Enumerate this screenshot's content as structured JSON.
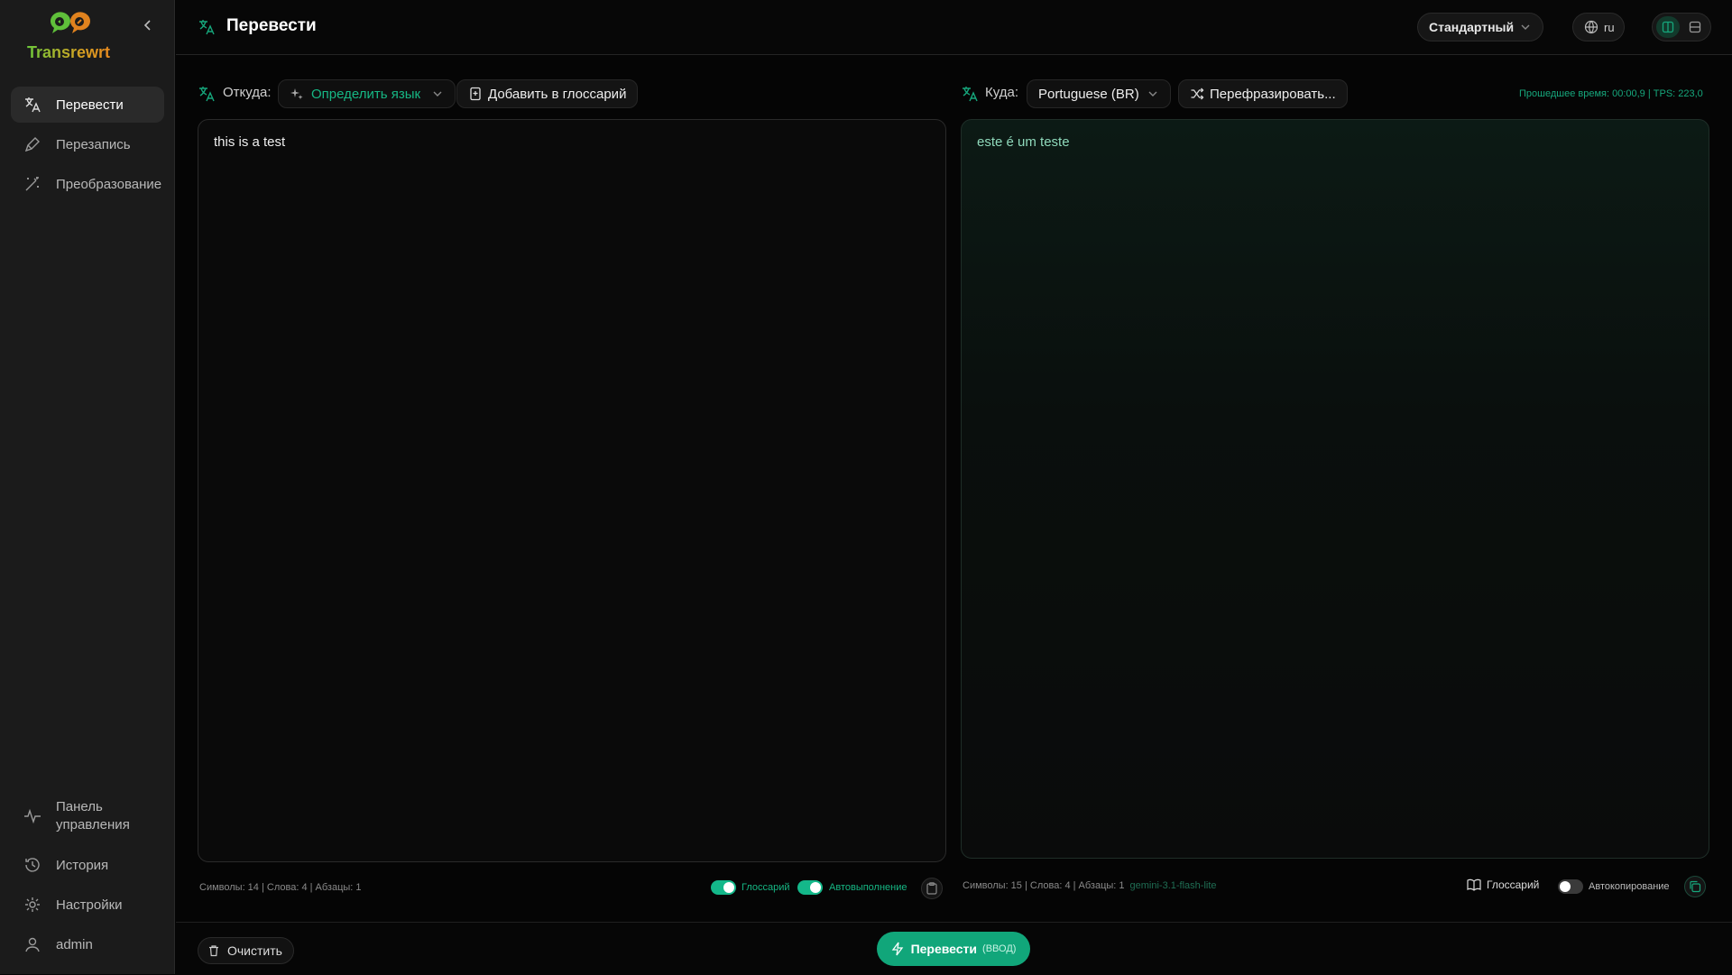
{
  "app": {
    "name": "Transrewrt"
  },
  "sidebar": {
    "items": [
      {
        "label": "Перевести",
        "icon": "translate-icon",
        "active": true
      },
      {
        "label": "Перезапись",
        "icon": "pen-icon",
        "active": false
      },
      {
        "label": "Преобразование",
        "icon": "magic-wand-icon",
        "active": false
      }
    ],
    "bottom_items": [
      {
        "label": "Панель управления",
        "icon": "activity-icon"
      },
      {
        "label": "История",
        "icon": "history-icon"
      },
      {
        "label": "Настройки",
        "icon": "gear-icon"
      },
      {
        "label": "admin",
        "icon": "user-icon"
      }
    ]
  },
  "header": {
    "title": "Перевести",
    "mode": "Стандартный",
    "language": "ru"
  },
  "source": {
    "from_label": "Откуда:",
    "detect_label": "Определить язык",
    "glossary_add_label": "Добавить в глоссарий",
    "text": "this is a test",
    "stats": "Символы: 14 | Слова: 4 | Абзацы: 1",
    "glossary_toggle_label": "Глоссарий",
    "glossary_toggle_on": true,
    "autocomplete_label": "Автовыполнение",
    "autocomplete_on": true
  },
  "target": {
    "to_label": "Куда:",
    "language": "Portuguese (BR)",
    "rephrase_label": "Перефразировать...",
    "elapsed": "Прошедшее время: 00:00,9 | TPS: 223,0",
    "text": "este é um teste",
    "stats": "Символы: 15 | Слова: 4 | Абзацы: 1",
    "model": "gemini-3.1-flash-lite",
    "glossary_label": "Глоссарий",
    "autocopy_label": "Автокопирование",
    "autocopy_on": false
  },
  "footer": {
    "clear_label": "Очистить",
    "translate_label": "Перевести",
    "translate_hint": "(ВВОД)"
  },
  "colors": {
    "accent": "#11a67a",
    "accent_text": "#16a77c",
    "background": "#050505",
    "sidebar": "#1b1b1b"
  }
}
